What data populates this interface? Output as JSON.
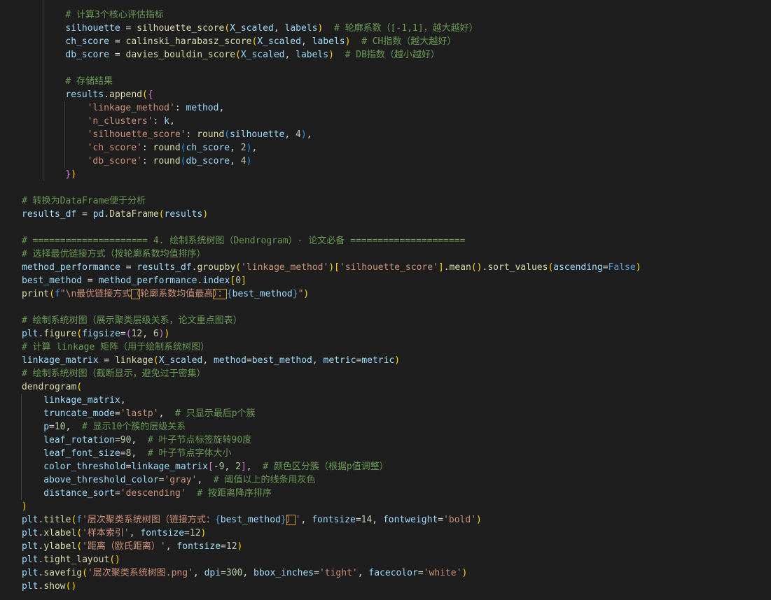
{
  "code_lines": [
    {
      "indent": 8,
      "tokens": [
        [
          "cm",
          "# 计算3个核心评估指标"
        ]
      ]
    },
    {
      "indent": 8,
      "tokens": [
        [
          "va",
          "silhouette"
        ],
        [
          "pl",
          " = "
        ],
        [
          "fn",
          "silhouette_score"
        ],
        [
          "b1",
          "("
        ],
        [
          "va",
          "X_scaled"
        ],
        [
          "pl",
          ", "
        ],
        [
          "va",
          "labels"
        ],
        [
          "b1",
          ")"
        ],
        [
          "pl",
          "  "
        ],
        [
          "cm",
          "# 轮廓系数（[-1,1]，越大越好）"
        ]
      ]
    },
    {
      "indent": 8,
      "tokens": [
        [
          "va",
          "ch_score"
        ],
        [
          "pl",
          " = "
        ],
        [
          "fn",
          "calinski_harabasz_score"
        ],
        [
          "b1",
          "("
        ],
        [
          "va",
          "X_scaled"
        ],
        [
          "pl",
          ", "
        ],
        [
          "va",
          "labels"
        ],
        [
          "b1",
          ")"
        ],
        [
          "pl",
          "  "
        ],
        [
          "cm",
          "# CH指数（越大越好）"
        ]
      ]
    },
    {
      "indent": 8,
      "tokens": [
        [
          "va",
          "db_score"
        ],
        [
          "pl",
          " = "
        ],
        [
          "fn",
          "davies_bouldin_score"
        ],
        [
          "b1",
          "("
        ],
        [
          "va",
          "X_scaled"
        ],
        [
          "pl",
          ", "
        ],
        [
          "va",
          "labels"
        ],
        [
          "b1",
          ")"
        ],
        [
          "pl",
          "  "
        ],
        [
          "cm",
          "# DB指数（越小越好）"
        ]
      ]
    },
    {
      "indent": 0,
      "tokens": []
    },
    {
      "indent": 8,
      "tokens": [
        [
          "cm",
          "# 存储结果"
        ]
      ]
    },
    {
      "indent": 8,
      "tokens": [
        [
          "va",
          "results"
        ],
        [
          "pl",
          "."
        ],
        [
          "fn",
          "append"
        ],
        [
          "b1",
          "("
        ],
        [
          "b2",
          "{"
        ]
      ]
    },
    {
      "indent": 12,
      "tokens": [
        [
          "st",
          "'linkage_method'"
        ],
        [
          "pl",
          ": "
        ],
        [
          "va",
          "method"
        ],
        [
          "pl",
          ","
        ]
      ]
    },
    {
      "indent": 12,
      "tokens": [
        [
          "st",
          "'n_clusters'"
        ],
        [
          "pl",
          ": "
        ],
        [
          "va",
          "k"
        ],
        [
          "pl",
          ","
        ]
      ]
    },
    {
      "indent": 12,
      "tokens": [
        [
          "st",
          "'silhouette_score'"
        ],
        [
          "pl",
          ": "
        ],
        [
          "fn",
          "round"
        ],
        [
          "b3",
          "("
        ],
        [
          "va",
          "silhouette"
        ],
        [
          "pl",
          ", "
        ],
        [
          "nu",
          "4"
        ],
        [
          "b3",
          ")"
        ],
        [
          "pl",
          ","
        ]
      ]
    },
    {
      "indent": 12,
      "tokens": [
        [
          "st",
          "'ch_score'"
        ],
        [
          "pl",
          ": "
        ],
        [
          "fn",
          "round"
        ],
        [
          "b3",
          "("
        ],
        [
          "va",
          "ch_score"
        ],
        [
          "pl",
          ", "
        ],
        [
          "nu",
          "2"
        ],
        [
          "b3",
          ")"
        ],
        [
          "pl",
          ","
        ]
      ]
    },
    {
      "indent": 12,
      "tokens": [
        [
          "st",
          "'db_score'"
        ],
        [
          "pl",
          ": "
        ],
        [
          "fn",
          "round"
        ],
        [
          "b3",
          "("
        ],
        [
          "va",
          "db_score"
        ],
        [
          "pl",
          ", "
        ],
        [
          "nu",
          "4"
        ],
        [
          "b3",
          ")"
        ]
      ]
    },
    {
      "indent": 8,
      "tokens": [
        [
          "b2",
          "}"
        ],
        [
          "b1",
          ")"
        ]
      ]
    },
    {
      "indent": 0,
      "tokens": []
    },
    {
      "indent": 0,
      "tokens": [
        [
          "cm",
          "# 转换为DataFrame便于分析"
        ]
      ]
    },
    {
      "indent": 0,
      "tokens": [
        [
          "va",
          "results_df"
        ],
        [
          "pl",
          " = "
        ],
        [
          "va",
          "pd"
        ],
        [
          "pl",
          "."
        ],
        [
          "fn",
          "DataFrame"
        ],
        [
          "b1",
          "("
        ],
        [
          "va",
          "results"
        ],
        [
          "b1",
          ")"
        ]
      ]
    },
    {
      "indent": 0,
      "tokens": []
    },
    {
      "indent": 0,
      "tokens": [
        [
          "cm",
          "# ===================== 4. 绘制系统树图（Dendrogram）- 论文必备 ====================="
        ]
      ]
    },
    {
      "indent": 0,
      "tokens": [
        [
          "cm",
          "# 选择最优链接方式（按轮廓系数均值排序）"
        ]
      ]
    },
    {
      "indent": 0,
      "tokens": [
        [
          "va",
          "method_performance"
        ],
        [
          "pl",
          " = "
        ],
        [
          "va",
          "results_df"
        ],
        [
          "pl",
          "."
        ],
        [
          "fn",
          "groupby"
        ],
        [
          "b1",
          "("
        ],
        [
          "st",
          "'linkage_method'"
        ],
        [
          "b1",
          ")"
        ],
        [
          "b1",
          "["
        ],
        [
          "st",
          "'silhouette_score'"
        ],
        [
          "b1",
          "]"
        ],
        [
          "pl",
          "."
        ],
        [
          "fn",
          "mean"
        ],
        [
          "b1",
          "()"
        ],
        [
          "pl",
          "."
        ],
        [
          "fn",
          "sort_values"
        ],
        [
          "b1",
          "("
        ],
        [
          "va",
          "ascending"
        ],
        [
          "pl",
          "="
        ],
        [
          "kw",
          "False"
        ],
        [
          "b1",
          ")"
        ]
      ]
    },
    {
      "indent": 0,
      "tokens": [
        [
          "va",
          "best_method"
        ],
        [
          "pl",
          " = "
        ],
        [
          "va",
          "method_performance"
        ],
        [
          "pl",
          "."
        ],
        [
          "va",
          "index"
        ],
        [
          "b1",
          "["
        ],
        [
          "nu",
          "0"
        ],
        [
          "b1",
          "]"
        ]
      ]
    },
    {
      "indent": 0,
      "tokens": [
        [
          "fn",
          "print"
        ],
        [
          "b1",
          "("
        ],
        [
          "kw",
          "f"
        ],
        [
          "st",
          "\"\\n最优链接方式"
        ],
        [
          "st",
          "（",
          "hl"
        ],
        [
          "st",
          "轮廓系数均值最高"
        ],
        [
          "st",
          "）：",
          "hl"
        ],
        [
          "kw",
          "{"
        ],
        [
          "va",
          "best_method"
        ],
        [
          "kw",
          "}"
        ],
        [
          "st",
          "\""
        ],
        [
          "b1",
          ")"
        ]
      ]
    },
    {
      "indent": 0,
      "tokens": []
    },
    {
      "indent": 0,
      "tokens": [
        [
          "cm",
          "# 绘制系统树图（展示聚类层级关系，论文重点图表）"
        ]
      ]
    },
    {
      "indent": 0,
      "tokens": [
        [
          "va",
          "plt"
        ],
        [
          "pl",
          "."
        ],
        [
          "fn",
          "figure"
        ],
        [
          "b1",
          "("
        ],
        [
          "va",
          "figsize"
        ],
        [
          "pl",
          "="
        ],
        [
          "b2",
          "("
        ],
        [
          "nu",
          "12"
        ],
        [
          "pl",
          ", "
        ],
        [
          "nu",
          "6"
        ],
        [
          "b2",
          ")"
        ],
        [
          "b1",
          ")"
        ]
      ]
    },
    {
      "indent": 0,
      "tokens": [
        [
          "cm",
          "# 计算 linkage 矩阵（用于绘制系统树图）"
        ]
      ]
    },
    {
      "indent": 0,
      "tokens": [
        [
          "va",
          "linkage_matrix"
        ],
        [
          "pl",
          " = "
        ],
        [
          "fn",
          "linkage"
        ],
        [
          "b1",
          "("
        ],
        [
          "va",
          "X_scaled"
        ],
        [
          "pl",
          ", "
        ],
        [
          "va",
          "method"
        ],
        [
          "pl",
          "="
        ],
        [
          "va",
          "best_method"
        ],
        [
          "pl",
          ", "
        ],
        [
          "va",
          "metric"
        ],
        [
          "pl",
          "="
        ],
        [
          "va",
          "metric"
        ],
        [
          "b1",
          ")"
        ]
      ]
    },
    {
      "indent": 0,
      "tokens": [
        [
          "cm",
          "# 绘制系统树图（截断显示，避免过于密集）"
        ]
      ]
    },
    {
      "indent": 0,
      "tokens": [
        [
          "fn",
          "dendrogram"
        ],
        [
          "b1",
          "("
        ]
      ]
    },
    {
      "indent": 4,
      "tokens": [
        [
          "va",
          "linkage_matrix"
        ],
        [
          "pl",
          ","
        ]
      ]
    },
    {
      "indent": 4,
      "tokens": [
        [
          "va",
          "truncate_mode"
        ],
        [
          "pl",
          "="
        ],
        [
          "st",
          "'lastp'"
        ],
        [
          "pl",
          ",  "
        ],
        [
          "cm",
          "# 只显示最后p个簇"
        ]
      ]
    },
    {
      "indent": 4,
      "tokens": [
        [
          "va",
          "p"
        ],
        [
          "pl",
          "="
        ],
        [
          "nu",
          "10"
        ],
        [
          "pl",
          ",  "
        ],
        [
          "cm",
          "# 显示10个簇的层级关系"
        ]
      ]
    },
    {
      "indent": 4,
      "tokens": [
        [
          "va",
          "leaf_rotation"
        ],
        [
          "pl",
          "="
        ],
        [
          "nu",
          "90"
        ],
        [
          "pl",
          ",  "
        ],
        [
          "cm",
          "# 叶子节点标签旋转90度"
        ]
      ]
    },
    {
      "indent": 4,
      "tokens": [
        [
          "va",
          "leaf_font_size"
        ],
        [
          "pl",
          "="
        ],
        [
          "nu",
          "8"
        ],
        [
          "pl",
          ",  "
        ],
        [
          "cm",
          "# 叶子节点字体大小"
        ]
      ]
    },
    {
      "indent": 4,
      "tokens": [
        [
          "va",
          "color_threshold"
        ],
        [
          "pl",
          "="
        ],
        [
          "va",
          "linkage_matrix"
        ],
        [
          "b2",
          "["
        ],
        [
          "pl",
          "-"
        ],
        [
          "nu",
          "9"
        ],
        [
          "pl",
          ", "
        ],
        [
          "nu",
          "2"
        ],
        [
          "b2",
          "]"
        ],
        [
          "pl",
          ",  "
        ],
        [
          "cm",
          "# 颜色区分簇（根据p值调整）"
        ]
      ]
    },
    {
      "indent": 4,
      "tokens": [
        [
          "va",
          "above_threshold_color"
        ],
        [
          "pl",
          "="
        ],
        [
          "st",
          "'gray'"
        ],
        [
          "pl",
          ",  "
        ],
        [
          "cm",
          "# 阈值以上的线条用灰色"
        ]
      ]
    },
    {
      "indent": 4,
      "tokens": [
        [
          "va",
          "distance_sort"
        ],
        [
          "pl",
          "="
        ],
        [
          "st",
          "'descending'"
        ],
        [
          "pl",
          "  "
        ],
        [
          "cm",
          "# 按距离降序排序"
        ]
      ]
    },
    {
      "indent": 0,
      "tokens": [
        [
          "b1",
          ")"
        ]
      ]
    },
    {
      "indent": 0,
      "tokens": [
        [
          "va",
          "plt"
        ],
        [
          "pl",
          "."
        ],
        [
          "fn",
          "title"
        ],
        [
          "b1",
          "("
        ],
        [
          "kw",
          "f"
        ],
        [
          "st",
          "'层次聚类系统树图（链接方式："
        ],
        [
          "kw",
          "{"
        ],
        [
          "va",
          "best_method"
        ],
        [
          "kw",
          "}"
        ],
        [
          "st",
          "）",
          "hl"
        ],
        [
          "st",
          "'"
        ],
        [
          "pl",
          ", "
        ],
        [
          "va",
          "fontsize"
        ],
        [
          "pl",
          "="
        ],
        [
          "nu",
          "14"
        ],
        [
          "pl",
          ", "
        ],
        [
          "va",
          "fontweight"
        ],
        [
          "pl",
          "="
        ],
        [
          "st",
          "'bold'"
        ],
        [
          "b1",
          ")"
        ]
      ]
    },
    {
      "indent": 0,
      "tokens": [
        [
          "va",
          "plt"
        ],
        [
          "pl",
          "."
        ],
        [
          "fn",
          "xlabel"
        ],
        [
          "b1",
          "("
        ],
        [
          "st",
          "'样本索引'"
        ],
        [
          "pl",
          ", "
        ],
        [
          "va",
          "fontsize"
        ],
        [
          "pl",
          "="
        ],
        [
          "nu",
          "12"
        ],
        [
          "b1",
          ")"
        ]
      ]
    },
    {
      "indent": 0,
      "tokens": [
        [
          "va",
          "plt"
        ],
        [
          "pl",
          "."
        ],
        [
          "fn",
          "ylabel"
        ],
        [
          "b1",
          "("
        ],
        [
          "st",
          "'距离（欧氏距离）'"
        ],
        [
          "pl",
          ", "
        ],
        [
          "va",
          "fontsize"
        ],
        [
          "pl",
          "="
        ],
        [
          "nu",
          "12"
        ],
        [
          "b1",
          ")"
        ]
      ]
    },
    {
      "indent": 0,
      "tokens": [
        [
          "va",
          "plt"
        ],
        [
          "pl",
          "."
        ],
        [
          "fn",
          "tight_layout"
        ],
        [
          "b1",
          "()"
        ]
      ]
    },
    {
      "indent": 0,
      "tokens": [
        [
          "va",
          "plt"
        ],
        [
          "pl",
          "."
        ],
        [
          "fn",
          "savefig"
        ],
        [
          "b1",
          "("
        ],
        [
          "st",
          "'层次聚类系统树图.png'"
        ],
        [
          "pl",
          ", "
        ],
        [
          "va",
          "dpi"
        ],
        [
          "pl",
          "="
        ],
        [
          "nu",
          "300"
        ],
        [
          "pl",
          ", "
        ],
        [
          "va",
          "bbox_inches"
        ],
        [
          "pl",
          "="
        ],
        [
          "st",
          "'tight'"
        ],
        [
          "pl",
          ", "
        ],
        [
          "va",
          "facecolor"
        ],
        [
          "pl",
          "="
        ],
        [
          "st",
          "'white'"
        ],
        [
          "b1",
          ")"
        ]
      ]
    },
    {
      "indent": 0,
      "tokens": [
        [
          "va",
          "plt"
        ],
        [
          "pl",
          "."
        ],
        [
          "fn",
          "show"
        ],
        [
          "b1",
          "()"
        ]
      ]
    }
  ]
}
